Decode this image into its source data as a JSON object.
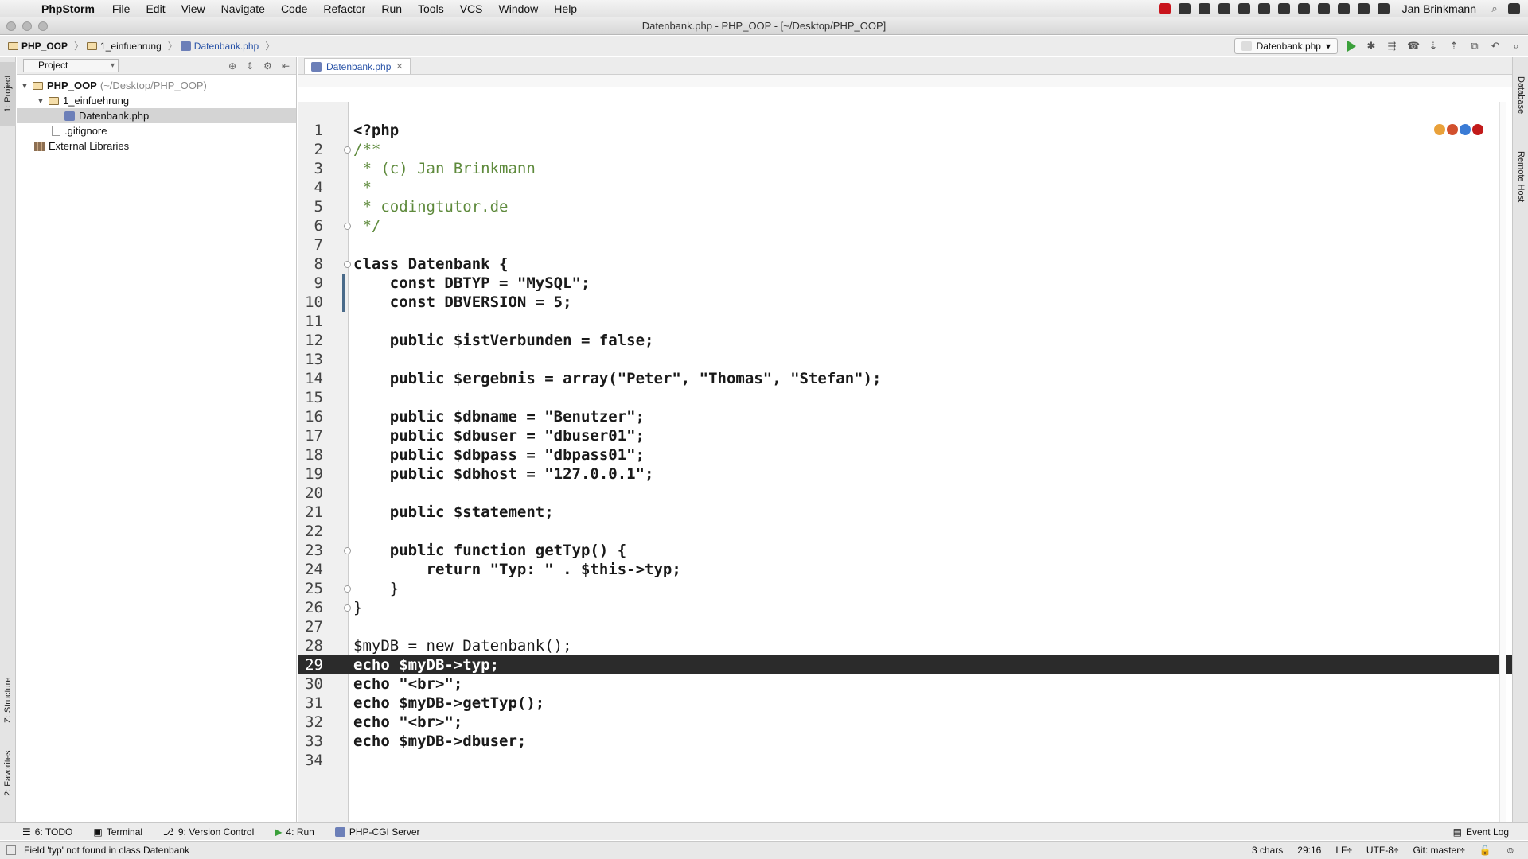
{
  "menubar": {
    "app_name": "PhpStorm",
    "items": [
      "File",
      "Edit",
      "View",
      "Navigate",
      "Code",
      "Refactor",
      "Run",
      "Tools",
      "VCS",
      "Window",
      "Help"
    ],
    "user": "Jan Brinkmann"
  },
  "window": {
    "title": "Datenbank.php - PHP_OOP - [~/Desktop/PHP_OOP]"
  },
  "navbar": {
    "crumbs": [
      "PHP_OOP",
      "1_einfuehrung",
      "Datenbank.php"
    ],
    "run_config": "Datenbank.php"
  },
  "project_panel": {
    "view_mode": "Project",
    "tree": [
      {
        "label": "PHP_OOP",
        "muted": "(~/Desktop/PHP_OOP)"
      },
      {
        "label": "1_einfuehrung"
      },
      {
        "label": "Datenbank.php"
      },
      {
        "label": ".gitignore"
      },
      {
        "label": "External Libraries"
      }
    ]
  },
  "editor": {
    "tab_label": "Datenbank.php",
    "current_line": 29,
    "lines": [
      {
        "n": "1",
        "code": "<?php"
      },
      {
        "n": "2",
        "code": "/**"
      },
      {
        "n": "3",
        "code": " * (c) Jan Brinkmann"
      },
      {
        "n": "4",
        "code": " *"
      },
      {
        "n": "5",
        "code": " * codingtutor.de"
      },
      {
        "n": "6",
        "code": " */"
      },
      {
        "n": "7",
        "code": ""
      },
      {
        "n": "8",
        "code": "class Datenbank {"
      },
      {
        "n": "9",
        "code": "    const DBTYP = \"MySQL\";"
      },
      {
        "n": "10",
        "code": "    const DBVERSION = 5;"
      },
      {
        "n": "11",
        "code": ""
      },
      {
        "n": "12",
        "code": "    public $istVerbunden = false;"
      },
      {
        "n": "13",
        "code": ""
      },
      {
        "n": "14",
        "code": "    public $ergebnis = array(\"Peter\", \"Thomas\", \"Stefan\");"
      },
      {
        "n": "15",
        "code": ""
      },
      {
        "n": "16",
        "code": "    public $dbname = \"Benutzer\";"
      },
      {
        "n": "17",
        "code": "    public $dbuser = \"dbuser01\";"
      },
      {
        "n": "18",
        "code": "    public $dbpass = \"dbpass01\";"
      },
      {
        "n": "19",
        "code": "    public $dbhost = \"127.0.0.1\";"
      },
      {
        "n": "20",
        "code": ""
      },
      {
        "n": "21",
        "code": "    public $statement;"
      },
      {
        "n": "22",
        "code": ""
      },
      {
        "n": "23",
        "code": "    public function getTyp() {"
      },
      {
        "n": "24",
        "code": "        return \"Typ: \" . $this->typ;"
      },
      {
        "n": "25",
        "code": "    }"
      },
      {
        "n": "26",
        "code": "}"
      },
      {
        "n": "27",
        "code": ""
      },
      {
        "n": "28",
        "code": "$myDB = new Datenbank();"
      },
      {
        "n": "29",
        "code": "echo $myDB->typ;"
      },
      {
        "n": "30",
        "code": "echo \"<br>\";"
      },
      {
        "n": "31",
        "code": "echo $myDB->getTyp();"
      },
      {
        "n": "32",
        "code": "echo \"<br>\";"
      },
      {
        "n": "33",
        "code": "echo $myDB->dbuser;"
      },
      {
        "n": "34",
        "code": ""
      }
    ]
  },
  "side_tabs": {
    "left": [
      "1: Project",
      "Z: Structure",
      "2: Favorites"
    ],
    "right": [
      "Database",
      "Remote Host"
    ]
  },
  "bottom_tools": [
    {
      "num": "6",
      "label": "6: TODO"
    },
    {
      "num": "",
      "label": "Terminal"
    },
    {
      "num": "9",
      "label": "9: Version Control"
    },
    {
      "num": "4",
      "label": "4: Run"
    },
    {
      "num": "",
      "label": "PHP-CGI Server"
    }
  ],
  "event_log": "Event Log",
  "status": {
    "message": "Field 'typ' not found in class Datenbank",
    "selection": "3 chars",
    "position": "29:16",
    "line_sep": "LF÷",
    "encoding": "UTF-8÷",
    "git": "Git: master÷"
  },
  "colors": {
    "keyword": "#a8420f",
    "comment": "#5e8a3c",
    "string": "#2b6e1e",
    "current_line_bg": "#2b2b2b"
  }
}
